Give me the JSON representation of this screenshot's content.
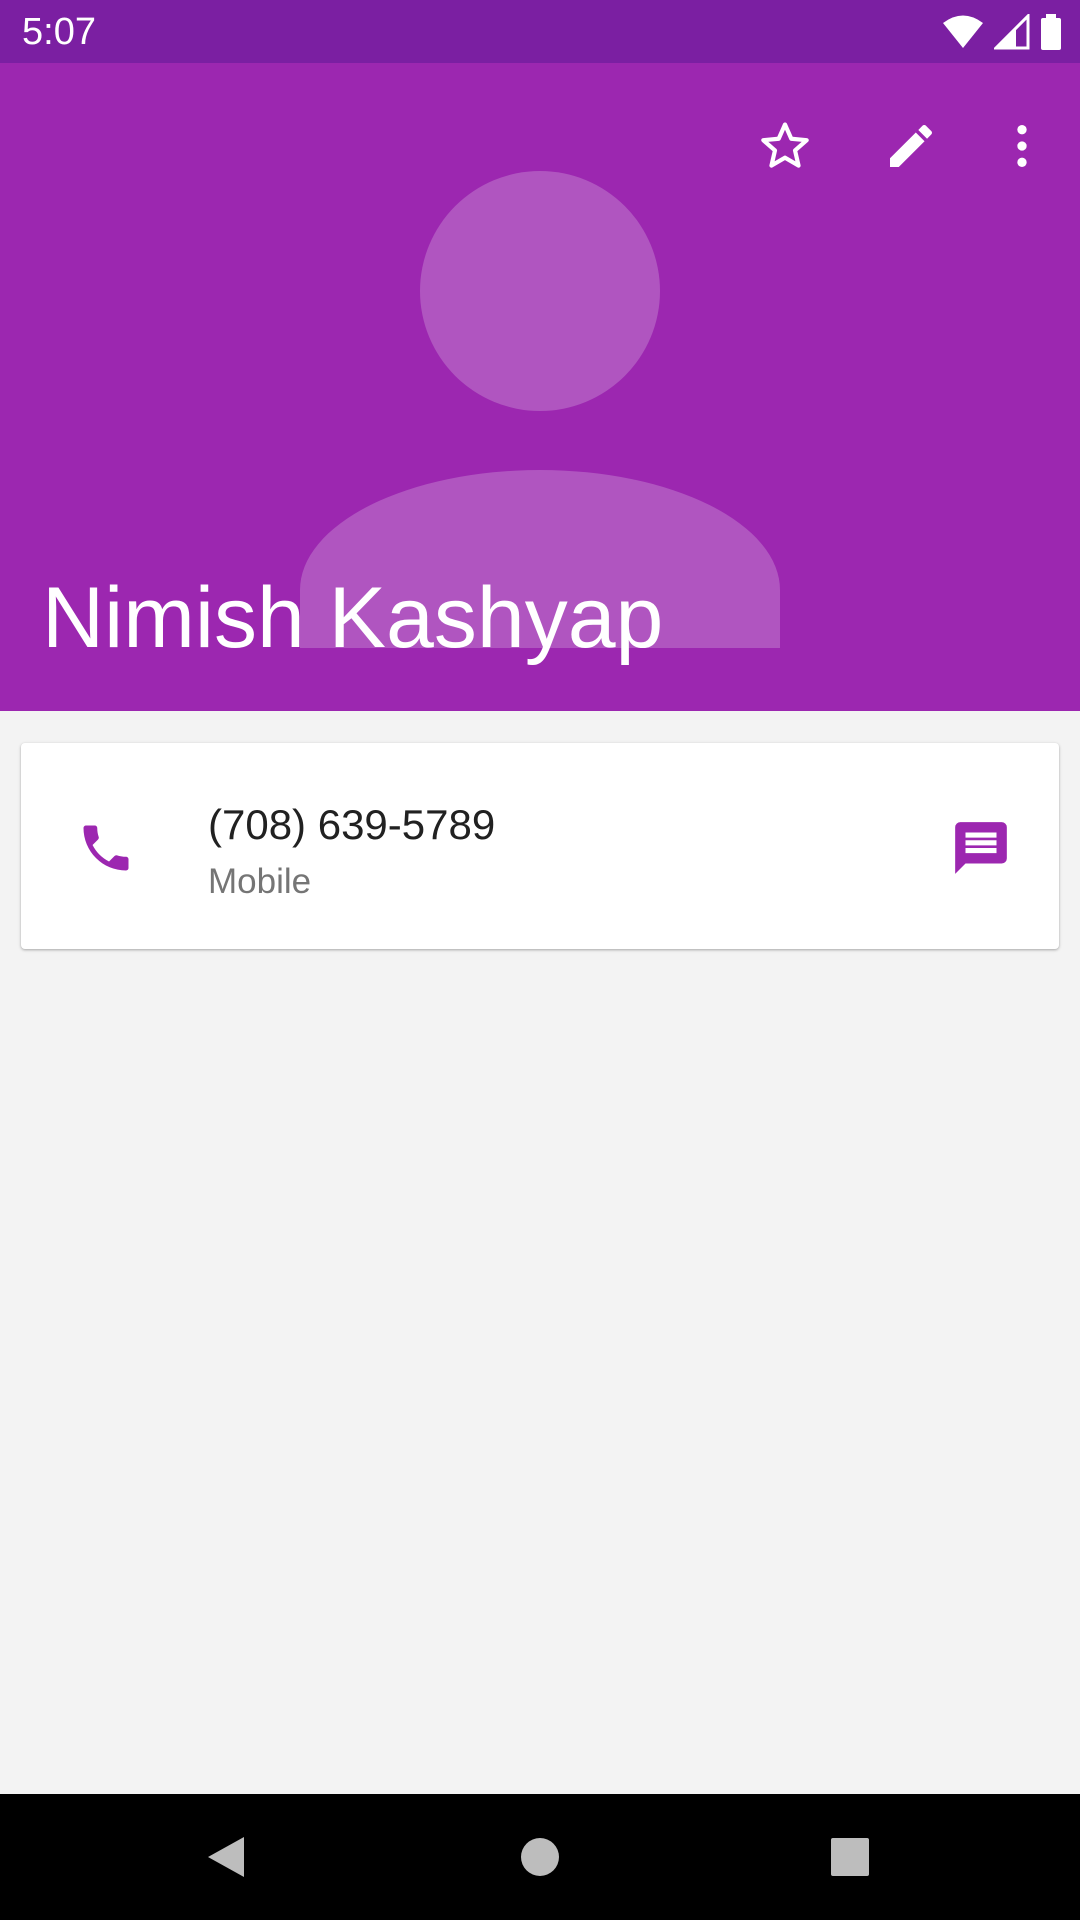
{
  "status_bar": {
    "time": "5:07",
    "icons": [
      "wifi-icon",
      "signal-icon",
      "battery-icon"
    ]
  },
  "header": {
    "contact_name": "Nimish Kashyap",
    "actions": [
      "star-icon",
      "edit-icon",
      "more-options-icon"
    ],
    "colors": {
      "primary": "#9c27b0",
      "primary_dark": "#7b1fa2",
      "avatar": "#b055c0"
    }
  },
  "phone_card": {
    "number": "(708) 639-5789",
    "type": "Mobile",
    "icons": [
      "phone-icon",
      "message-icon"
    ],
    "accent": "#9c27b0"
  },
  "nav_bar": {
    "buttons": [
      "back-icon",
      "home-icon",
      "recents-icon"
    ]
  }
}
